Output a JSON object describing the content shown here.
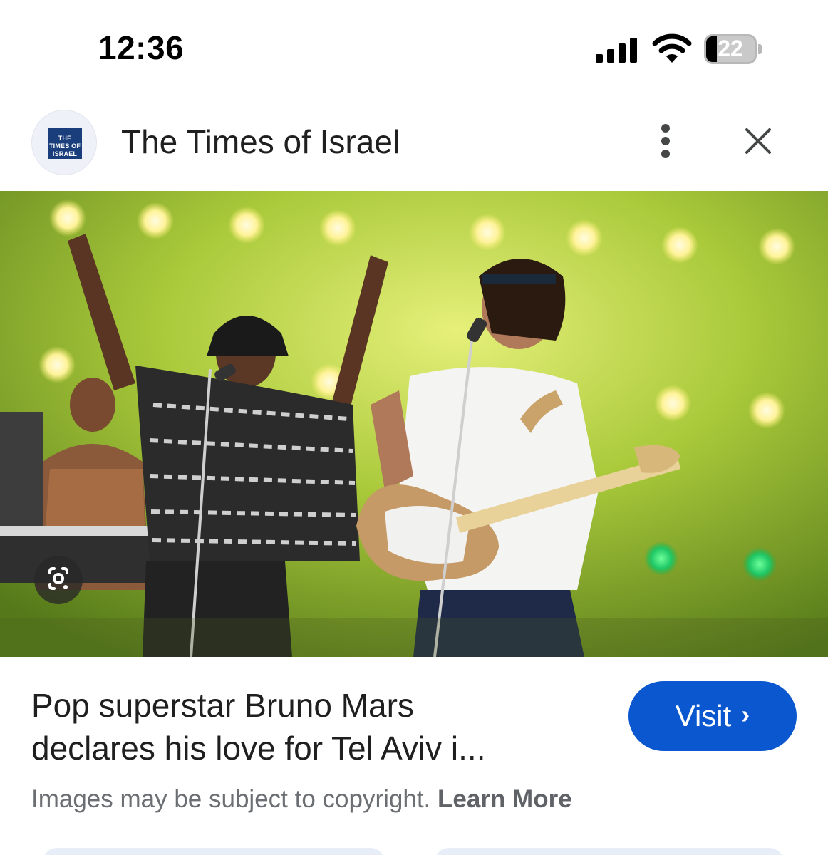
{
  "status_bar": {
    "time": "12:36",
    "battery_level": "22",
    "icons": [
      "signal-icon",
      "wifi-icon",
      "battery-icon"
    ]
  },
  "header": {
    "logo_text": "THE TIMES OF ISRAEL",
    "source_name": "The Times of Israel",
    "more_icon": "more-vert-icon",
    "close_icon": "close-icon"
  },
  "image": {
    "lens_icon": "google-lens-icon"
  },
  "article": {
    "headline_line1": "Pop superstar Bruno Mars",
    "headline_line2": "declares his love for Tel Aviv i...",
    "visit_label": "Visit",
    "copyright_text": "Images may be subject to copyright.",
    "learn_more_label": "Learn More"
  },
  "colors": {
    "accent": "#0b57d0",
    "logo_bg": "#1a3d7c",
    "stage_green": "#9bc23a"
  }
}
